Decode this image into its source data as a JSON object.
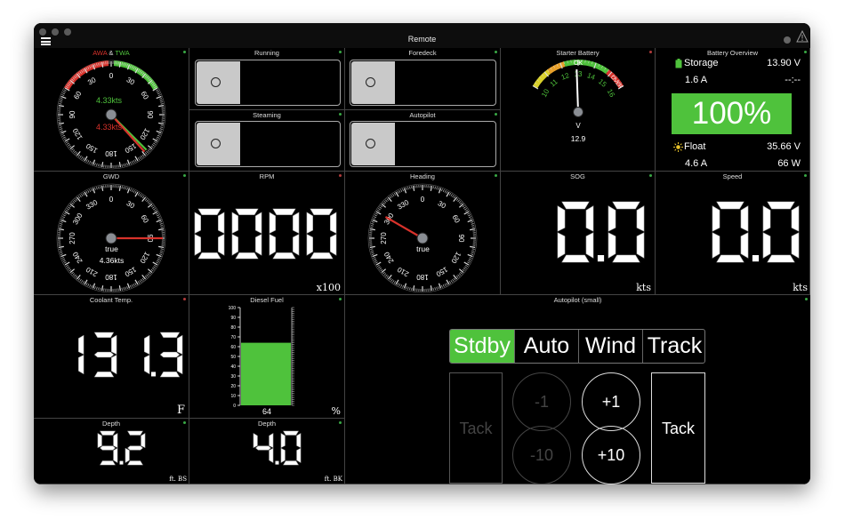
{
  "window": {
    "title": "Remote"
  },
  "colors": {
    "green": "#4fc23c",
    "red": "#d8322b",
    "orange": "#e8a02a",
    "yellow": "#d8d02a"
  },
  "wind": {
    "title_awa": "AWA",
    "title_amp": "&",
    "title_twa": "TWA",
    "speed1": "4.33kts",
    "speed2": "4.33kts",
    "ticks": [
      "0",
      "30",
      "60",
      "90",
      "120",
      "150",
      "180",
      "150",
      "120",
      "90",
      "60",
      "30"
    ]
  },
  "running": {
    "title": "Running",
    "on": false
  },
  "foredeck": {
    "title": "Foredeck",
    "on": false
  },
  "steaming": {
    "title": "Steaming",
    "on": false
  },
  "autopilot_switch": {
    "title": "Autopilot",
    "on": false
  },
  "starter": {
    "title": "Starter Battery",
    "status": "OK",
    "over": "OVER",
    "unit": "V",
    "value": "12.9",
    "ticks": [
      "10",
      "11",
      "12",
      "13",
      "14",
      "15",
      "16"
    ],
    "value_num": 12.9
  },
  "battery": {
    "title": "Battery Overview",
    "mode": "Storage",
    "voltage": "13.90 V",
    "current": "1.6 A",
    "time": "--:--",
    "soc": "100%",
    "charge": "Float",
    "solar_v": "35.66 V",
    "solar_a": "4.6 A",
    "solar_w": "66 W"
  },
  "gwd": {
    "title": "GWD",
    "ref": "true",
    "speed": "4.36kts",
    "direction_deg": 90,
    "ticks": [
      "0",
      "30",
      "60",
      "90",
      "120",
      "150",
      "180",
      "210",
      "240",
      "270",
      "300",
      "330"
    ]
  },
  "rpm": {
    "title": "RPM",
    "value": "0000",
    "unit": "x100"
  },
  "heading": {
    "title": "Heading",
    "ref": "true",
    "direction_deg": 300,
    "ticks": [
      "0",
      "30",
      "60",
      "90",
      "120",
      "150",
      "180",
      "210",
      "240",
      "270",
      "300",
      "330"
    ]
  },
  "sog": {
    "title": "SOG",
    "value": "0.0",
    "unit": "kts"
  },
  "speed": {
    "title": "Speed",
    "value": "0.0",
    "unit": "kts"
  },
  "coolant": {
    "title": "Coolant Temp.",
    "value": "131.3",
    "unit": "F"
  },
  "fuel": {
    "title": "Diesel Fuel",
    "value": "64",
    "value_num": 64,
    "unit": "%",
    "ticks": [
      "100",
      "90",
      "80",
      "70",
      "60",
      "50",
      "40",
      "30",
      "20",
      "10",
      "0"
    ]
  },
  "autopilot": {
    "title": "Autopilot (small)",
    "modes": [
      "Stdby",
      "Auto",
      "Wind",
      "Track"
    ],
    "active_mode": "Stdby",
    "tack_left": "Tack",
    "tack_right": "Tack",
    "minus1": "-1",
    "plus1": "+1",
    "minus10": "-10",
    "plus10": "+10"
  },
  "depth1": {
    "title": "Depth",
    "value": "9.2",
    "unit": "ft. BS"
  },
  "depth2": {
    "title": "Depth",
    "value": "4.0",
    "unit": "ft. BK"
  }
}
